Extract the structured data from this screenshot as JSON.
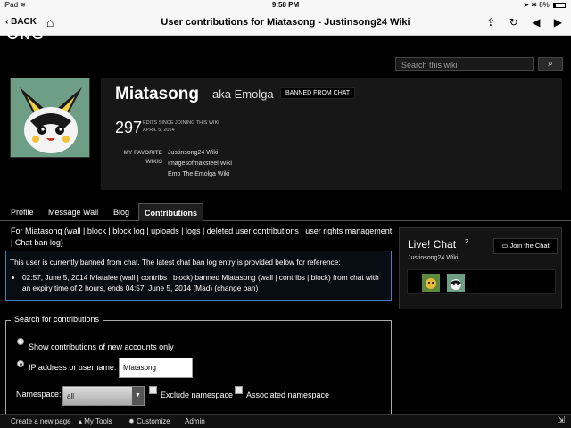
{
  "status_bar": {
    "device": "iPad",
    "time": "9:58 PM",
    "battery": "8%"
  },
  "app_bar": {
    "back_label": "BACK",
    "title": "User contributions for Miatasong - Justinsong24 Wiki"
  },
  "wiki": {
    "logo_fragment": "ONG",
    "search_placeholder": "Search this wiki"
  },
  "profile": {
    "username": "Miatasong",
    "aka": "aka Emolga",
    "badge": "BANNED FROM CHAT",
    "edit_count": "297",
    "edits_label": "EDITS SINCE JOINING THIS WIKI",
    "join_date": "APRIL 5, 2014",
    "favorite_label": "MY FAVORITE WIKIS",
    "favorites": [
      "Justinsong24 Wiki",
      "Imagesofmaxsteel Wiki",
      "Emo The Emolga Wiki"
    ]
  },
  "tabs": [
    {
      "label": "Profile",
      "active": false
    },
    {
      "label": "Message Wall",
      "active": false
    },
    {
      "label": "Blog",
      "active": false
    },
    {
      "label": "Contributions",
      "active": true
    }
  ],
  "contrib_header": "For Miatasong (wall | block | block log | uploads | logs | deleted user contributions | user rights management | Chat ban log)",
  "ban_notice": {
    "intro": "This user is currently banned from chat. The latest chat ban log entry is provided below for reference:",
    "entry": "02:57, June 5, 2014 Miatalee (wall | contribs | block) banned Miatasong (wall | contribs | block) from chat with an expiry time of 2 hours, ends 04:57, June 5, 2014 (Mad) (change ban)"
  },
  "chat": {
    "title": "Live! Chat",
    "count": "2",
    "wiki_name": "Justinsong24 Wiki",
    "join_label": "Join the Chat"
  },
  "search_form": {
    "legend": "Search for contributions",
    "radio_new_accounts": "Show contributions of new accounts only",
    "radio_ip_user": "IP address or username:",
    "ip_value": "Miatasong",
    "namespace_label": "Namespace:",
    "namespace_value": "all",
    "exclude_label": "Exclude namespace",
    "associated_label": "Associated namespace"
  },
  "toolbar": {
    "create_page": "Create a new page",
    "my_tools": "My Tools",
    "customize": "Customize",
    "admin": "Admin"
  }
}
